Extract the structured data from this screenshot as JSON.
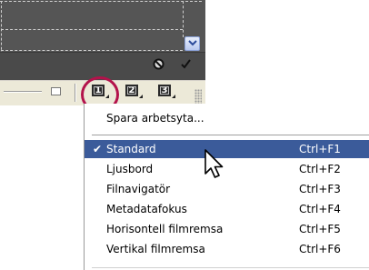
{
  "panel": {
    "scroll_icon": "chevron-down-icon",
    "status_icons": [
      "no-symbol-icon",
      "checkmark-icon"
    ]
  },
  "toolbar": {
    "workspace_buttons": [
      {
        "number": "1",
        "icon": "workspace-1-icon"
      },
      {
        "number": "2",
        "icon": "workspace-2-icon"
      },
      {
        "number": "3",
        "icon": "workspace-3-icon"
      }
    ],
    "highlight_color": "#b3124b"
  },
  "menu": {
    "save_label": "Spara arbetsyta...",
    "items": [
      {
        "label": "Standard",
        "shortcut": "Ctrl+F1",
        "checked": true,
        "selected": true
      },
      {
        "label": "Ljusbord",
        "shortcut": "Ctrl+F2"
      },
      {
        "label": "Filnavigatör",
        "shortcut": "Ctrl+F3"
      },
      {
        "label": "Metadatafokus",
        "shortcut": "Ctrl+F4"
      },
      {
        "label": "Horisontell filmremsa",
        "shortcut": "Ctrl+F5"
      },
      {
        "label": "Vertikal filmremsa",
        "shortcut": "Ctrl+F6"
      }
    ],
    "selected_color": "#3b5b9a"
  }
}
